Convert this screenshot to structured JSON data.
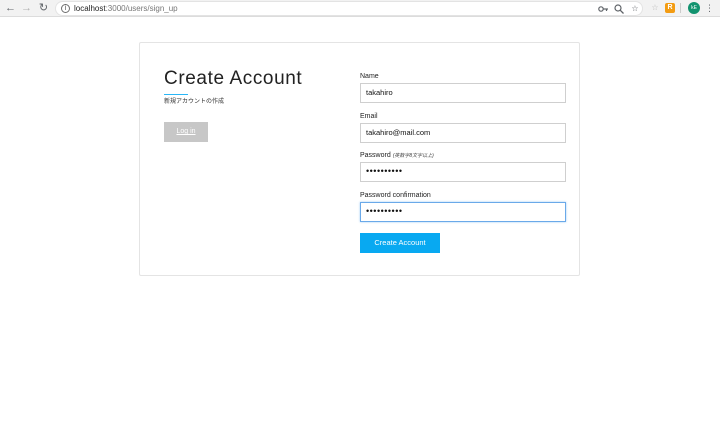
{
  "browser": {
    "url_host": "localhost",
    "url_path": ":3000/users/sign_up",
    "avatar_initials": "kE"
  },
  "page": {
    "title": "Create Account",
    "subtitle": "新規アカウントの作成",
    "login_label": "Log in",
    "accent_color": "#29b6f6"
  },
  "form": {
    "name": {
      "label": "Name",
      "value": "takahiro"
    },
    "email": {
      "label": "Email",
      "value": "takahiro@mail.com"
    },
    "password": {
      "label": "Password",
      "note": "(英数字8文字以上)",
      "value": "••••••••••"
    },
    "password_confirmation": {
      "label": "Password confirmation",
      "value": "••••••••••"
    },
    "submit_label": "Create Account",
    "submit_color": "#08a9f1"
  }
}
